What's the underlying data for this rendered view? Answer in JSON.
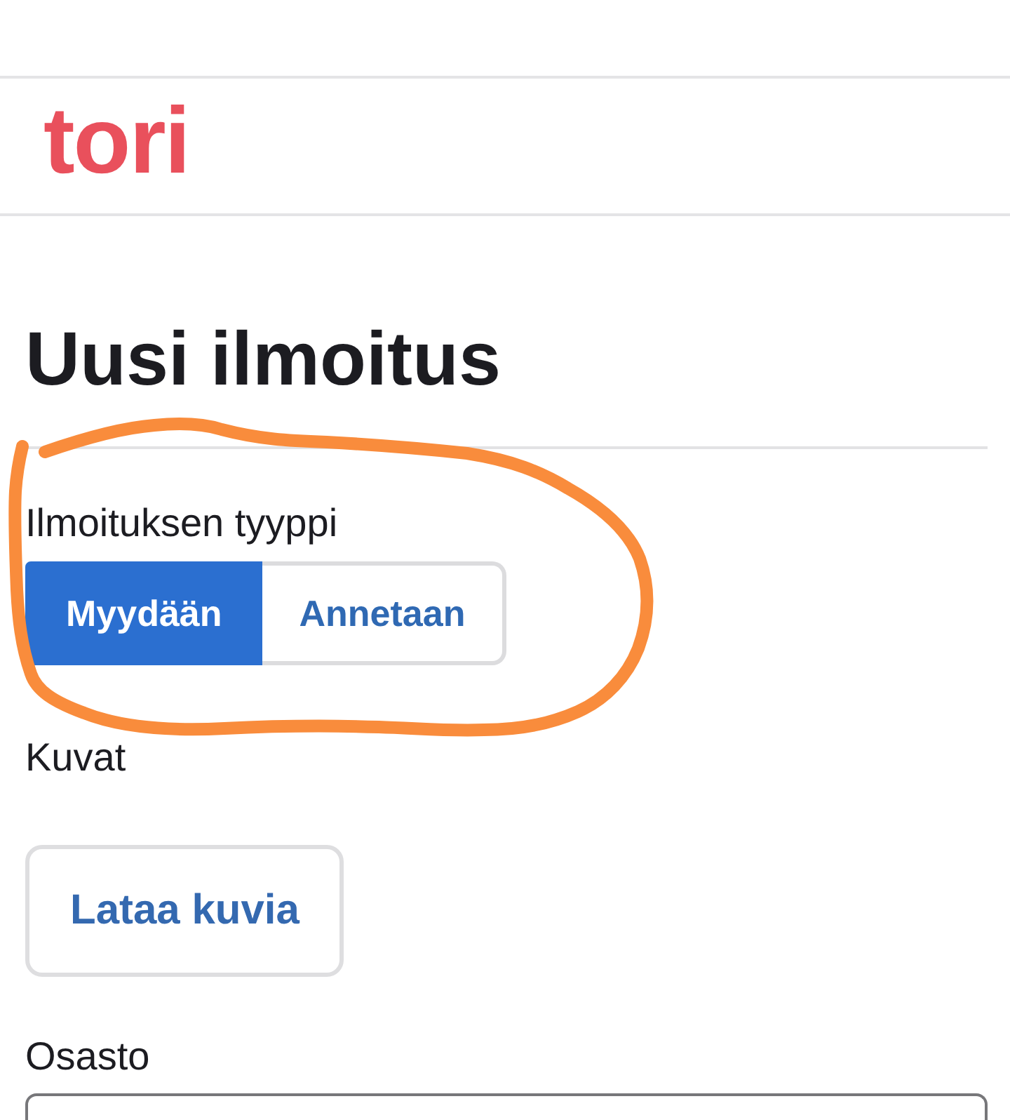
{
  "header": {
    "logo": "tori"
  },
  "page": {
    "title": "Uusi ilmoitus"
  },
  "form": {
    "listing_type": {
      "label": "Ilmoituksen tyyppi",
      "options": [
        {
          "label": "Myydään",
          "selected": true
        },
        {
          "label": "Annetaan",
          "selected": false
        }
      ]
    },
    "images": {
      "label": "Kuvat",
      "button": "Lataa kuvia"
    },
    "category": {
      "label": "Osasto"
    }
  }
}
